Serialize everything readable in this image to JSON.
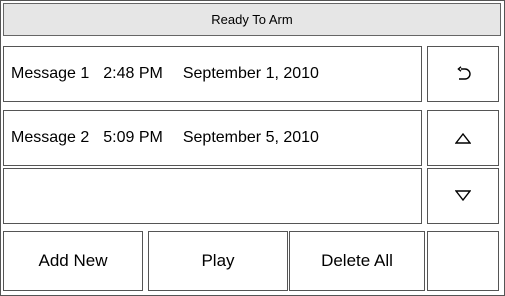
{
  "header": {
    "title": "Ready To Arm"
  },
  "messages": [
    {
      "name": "Message 1",
      "time": "2:48 PM",
      "date": "September 1, 2010"
    },
    {
      "name": "Message 2",
      "time": "5:09 PM",
      "date": "September 5, 2010"
    }
  ],
  "side_buttons": {
    "back_icon": "back-arrow-icon",
    "up_icon": "triangle-up-icon",
    "down_icon": "triangle-down-icon"
  },
  "bottom_buttons": {
    "add_new": "Add New",
    "play": "Play",
    "delete_all": "Delete All",
    "blank": ""
  }
}
